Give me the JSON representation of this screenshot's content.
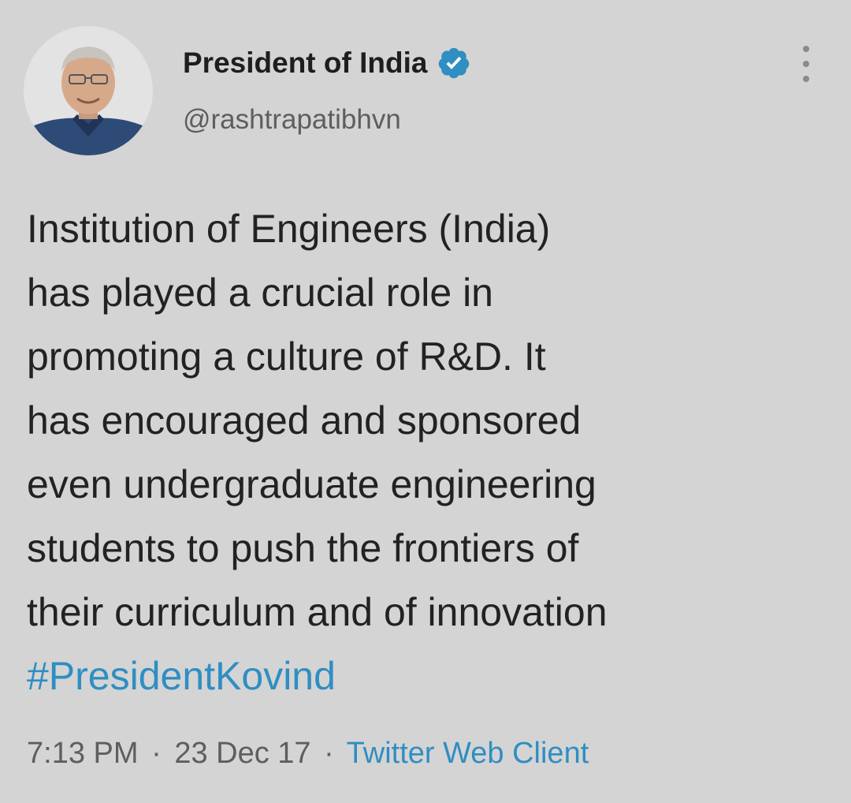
{
  "tweet": {
    "author": {
      "display_name": "President of India",
      "handle": "@rashtrapatibhvn",
      "verified": true
    },
    "body_lines": [
      "Institution of Engineers (India)",
      "has played a crucial role in",
      "promoting a culture of R&D. It",
      "has encouraged and sponsored",
      "even undergraduate engineering",
      "students to push the frontiers of",
      "their curriculum and of innovation"
    ],
    "hashtag": "#PresidentKovind",
    "time": "7:13 PM",
    "date": "23 Dec 17",
    "separator": "·",
    "client": "Twitter Web Client"
  },
  "icons": {
    "verified": "verified-badge-icon",
    "more": "more-options-icon"
  },
  "colors": {
    "background": "#d4d4d4",
    "text": "#222222",
    "secondary_text": "#5e5e5e",
    "link": "#2f8ec2",
    "verified_badge": "#2f8ec2"
  }
}
